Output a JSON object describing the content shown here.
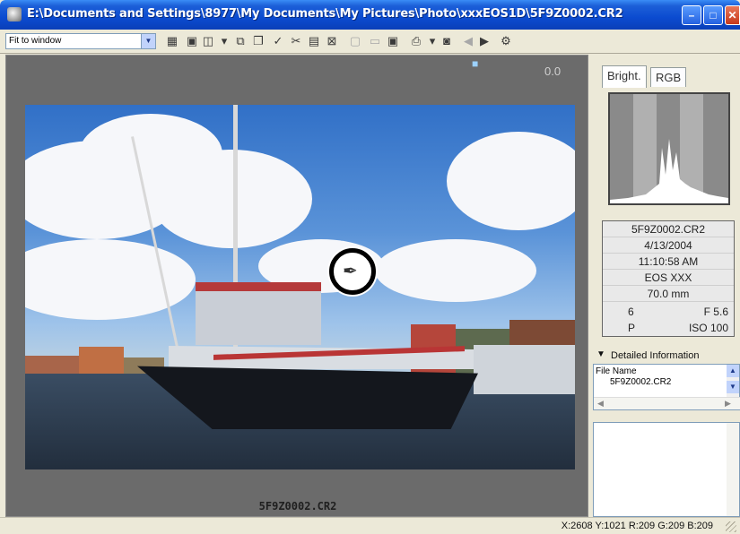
{
  "window": {
    "title": "E:\\Documents and Settings\\8977\\My Documents\\My Pictures\\Photo\\xxxEOS1D\\5F9Z0002.CR2",
    "minimize": "–",
    "maximize": "□",
    "close": "✕"
  },
  "toolbar": {
    "fit_value": "Fit to window",
    "icons": [
      "grid-view-icon",
      "image-view-icon",
      "dual-view-icon",
      "copy-icon",
      "paste-icon",
      "check-icon",
      "cut-icon",
      "image-icon",
      "compare-icon",
      "raw-icon",
      "jpeg-icon",
      "thumbnail-icon",
      "print-icon",
      "save-icon",
      "prev-icon",
      "next-icon",
      "settings-icon"
    ]
  },
  "viewer": {
    "zoom_readout": "0.0",
    "file_caption": "5F9Z0002.CR2"
  },
  "panel": {
    "tabs": [
      "Bright.",
      "RGB"
    ],
    "info": {
      "filename": "5F9Z0002.CR2",
      "date": "4/13/2004",
      "time": "11:10:58 AM",
      "camera": "EOS XXX",
      "focal_length": "70.0 mm",
      "shutter": "6",
      "aperture": "F 5.6",
      "mode": "P",
      "iso": "ISO 100"
    },
    "detailed_header": "Detailed Information",
    "detail_key": "File Name",
    "detail_value": "5F9Z0002.CR2"
  },
  "status": {
    "text": "X:2608 Y:1021 R:209 G:209 B:209"
  },
  "colors": {
    "titlebar": "#0b4bd0",
    "viewer_bg": "#6b6b6b",
    "panel_bg": "#ece9d8"
  }
}
